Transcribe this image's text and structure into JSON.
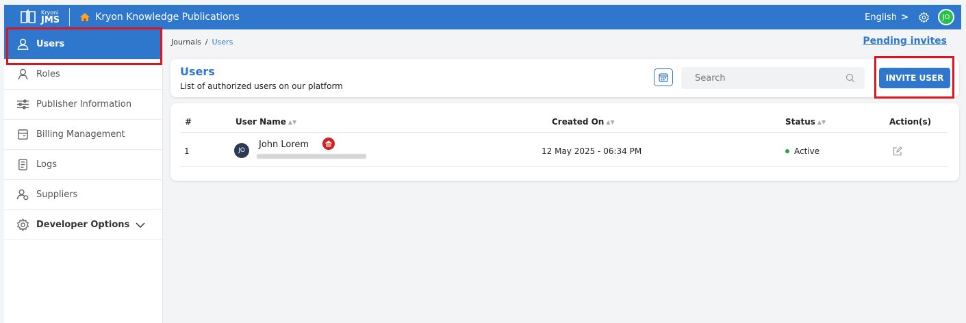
{
  "header": {
    "brand_small": "Kryoni",
    "brand_big": "JMS",
    "app_title": "Kryon Knowledge Publications",
    "language": "English",
    "user_initials": "JO",
    "colors": {
      "bar": "#2f77cc",
      "avatar": "#27c04a"
    }
  },
  "sidebar": {
    "items": [
      {
        "label": "Users",
        "icon": "user-icon"
      },
      {
        "label": "Roles",
        "icon": "roles-icon"
      },
      {
        "label": "Publisher Information",
        "icon": "sliders-icon"
      },
      {
        "label": "Billing Management",
        "icon": "billing-icon"
      },
      {
        "label": "Logs",
        "icon": "logs-icon"
      },
      {
        "label": "Suppliers",
        "icon": "suppliers-icon"
      },
      {
        "label": "Developer Options",
        "icon": "gear-icon"
      }
    ]
  },
  "breadcrumb": {
    "root": "Journals",
    "separator": "/",
    "current": "Users"
  },
  "pending_invites": "Pending invites",
  "users_card": {
    "title": "Users",
    "subtitle": "List of authorized users on our platform",
    "search_placeholder": "Search",
    "invite_label": "INVITE USER"
  },
  "table": {
    "columns": [
      "#",
      "User Name",
      "Created On",
      "Status",
      "Action(s)"
    ],
    "rows": [
      {
        "index": "1",
        "initials": "JO",
        "name": "John Lorem",
        "created_on": "12 May 2025 - 06:34 PM",
        "status": "Active"
      }
    ]
  }
}
